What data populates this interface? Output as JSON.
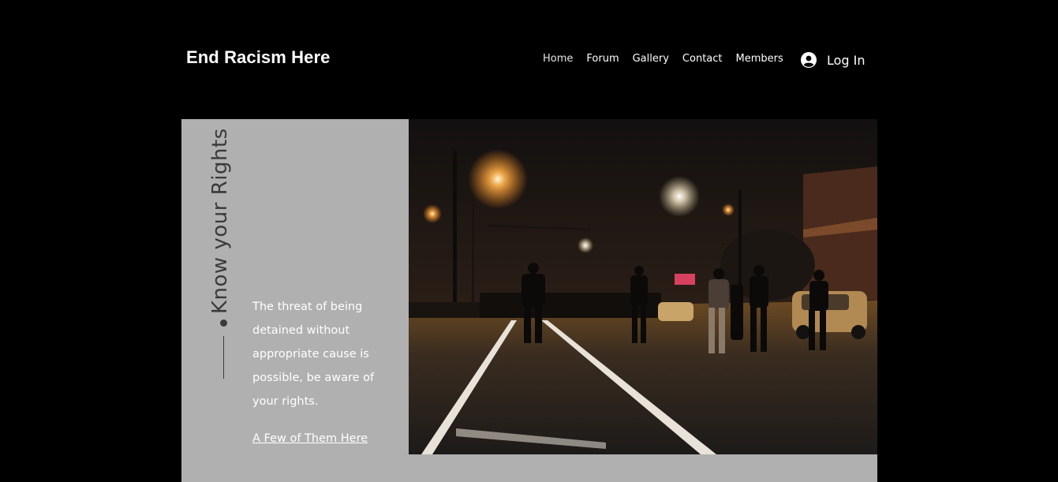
{
  "header": {
    "site_title": "End Racism Here",
    "nav": [
      {
        "label": "Home",
        "active": true
      },
      {
        "label": "Forum"
      },
      {
        "label": "Gallery"
      },
      {
        "label": "Contact"
      },
      {
        "label": "Members"
      }
    ],
    "login": {
      "label": "Log In",
      "icon": "user-avatar-icon"
    }
  },
  "section": {
    "vertical_title": "Know your Rights",
    "description": "The threat of being detained without appropriate cause is possible, be aware of your rights.",
    "link_label": "A Few of Them Here",
    "photo": {
      "subject": "night-street-protest-photo"
    }
  },
  "colors": {
    "background": "#000000",
    "panel": "#b0b0b0",
    "text_dark": "#3a3a3a",
    "text_light": "#ffffff"
  }
}
